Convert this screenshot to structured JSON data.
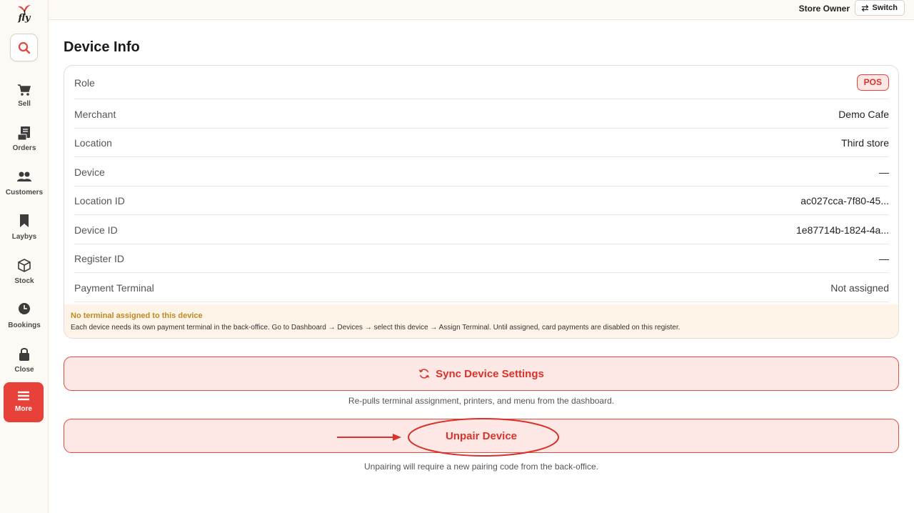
{
  "app": {
    "logo_text": "fly"
  },
  "sidebar": {
    "items": [
      {
        "label": "Sell",
        "icon": "cart-icon"
      },
      {
        "label": "Orders",
        "icon": "orders-icon"
      },
      {
        "label": "Customers",
        "icon": "customers-icon"
      },
      {
        "label": "Laybys",
        "icon": "bookmark-icon"
      },
      {
        "label": "Stock",
        "icon": "box-icon"
      },
      {
        "label": "Bookings",
        "icon": "clock-icon"
      },
      {
        "label": "Close",
        "icon": "lock-icon"
      },
      {
        "label": "More",
        "icon": "menu-icon",
        "active": true
      }
    ]
  },
  "topbar": {
    "user_role": "Store Owner",
    "switch_label": "Switch"
  },
  "page": {
    "title": "Device Info"
  },
  "info": {
    "rows": [
      {
        "key": "Role",
        "value": "POS"
      },
      {
        "key": "Merchant",
        "value": "Demo Cafe"
      },
      {
        "key": "Location",
        "value": "Third store"
      },
      {
        "key": "Device",
        "value": "—"
      },
      {
        "key": "Location ID",
        "value": "ac027cca-7f80-45..."
      },
      {
        "key": "Device ID",
        "value": "1e87714b-1824-4a..."
      },
      {
        "key": "Register ID",
        "value": "—"
      },
      {
        "key": "Payment Terminal",
        "value": "Not assigned"
      }
    ],
    "warning_title": "No terminal assigned to this device",
    "warning_text": "Each device needs its own payment terminal in the back-office. Go to Dashboard → Devices → select this device → Assign Terminal. Until assigned, card payments are disabled on this register."
  },
  "actions": {
    "sync_label": "Sync Device Settings",
    "sync_hint": "Re-pulls terminal assignment, printers, and menu from the dashboard.",
    "unpair_label": "Unpair Device",
    "unpair_hint": "Unpairing will require a new pairing code from the back-office."
  },
  "colors": {
    "accent": "#e8413a",
    "warning_title": "#c08822",
    "warning_bg": "#fdf4e7"
  }
}
